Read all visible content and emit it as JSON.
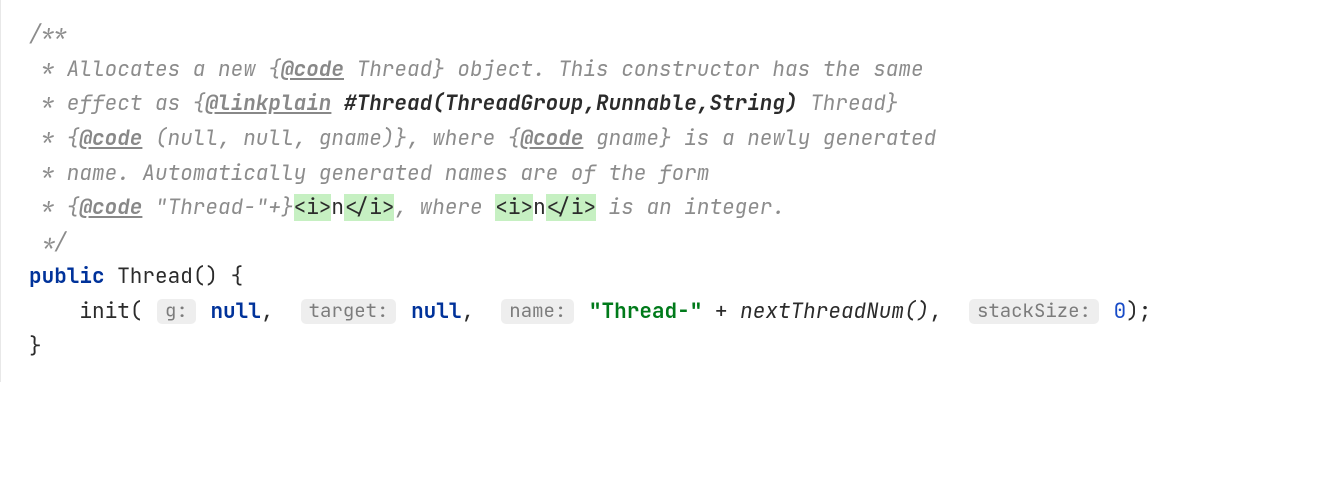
{
  "doc": {
    "open": "/**",
    "l1a": " * Allocates a new {",
    "l1_tag": "@code",
    "l1b": " Thread} object. This constructor has the same",
    "l2a": " * effect as {",
    "l2_tag": "@linkplain",
    "l2_ref": " #Thread(ThreadGroup,Runnable,String)",
    "l2b": " Thread}",
    "l3a": " * {",
    "l3_tag": "@code",
    "l3b": " (null, null, gname)}, where {",
    "l3_tag2": "@code",
    "l3c": " gname} is a newly generated",
    "l4": " * name. Automatically generated names are of the form",
    "l5a": " * {",
    "l5_tag": "@code",
    "l5_code_body": " \"Thread-\"+}",
    "l5_hl1a": "<i>",
    "l5_hl1b": "n",
    "l5_hl1c": "</i>",
    "l5_mid": ", where ",
    "l5_hl2a": "<i>",
    "l5_hl2b": "n",
    "l5_hl2c": "</i>",
    "l5_end": " is an integer.",
    "close": " */"
  },
  "sig": {
    "public": "public",
    "threadDecl": " Thread() {"
  },
  "body": {
    "indent": "    ",
    "init": "init(",
    "hint_g": "g:",
    "null1": "null",
    "comma": ", ",
    "hint_target": "target:",
    "null2": "null",
    "hint_name": "name:",
    "str": "\"Thread-\"",
    "plus": " + ",
    "next": "nextThreadNum()",
    "comma2": ", ",
    "hint_stack": "stackSize:",
    "zero": "0",
    "close_call": ");",
    "close_brace": "}"
  }
}
